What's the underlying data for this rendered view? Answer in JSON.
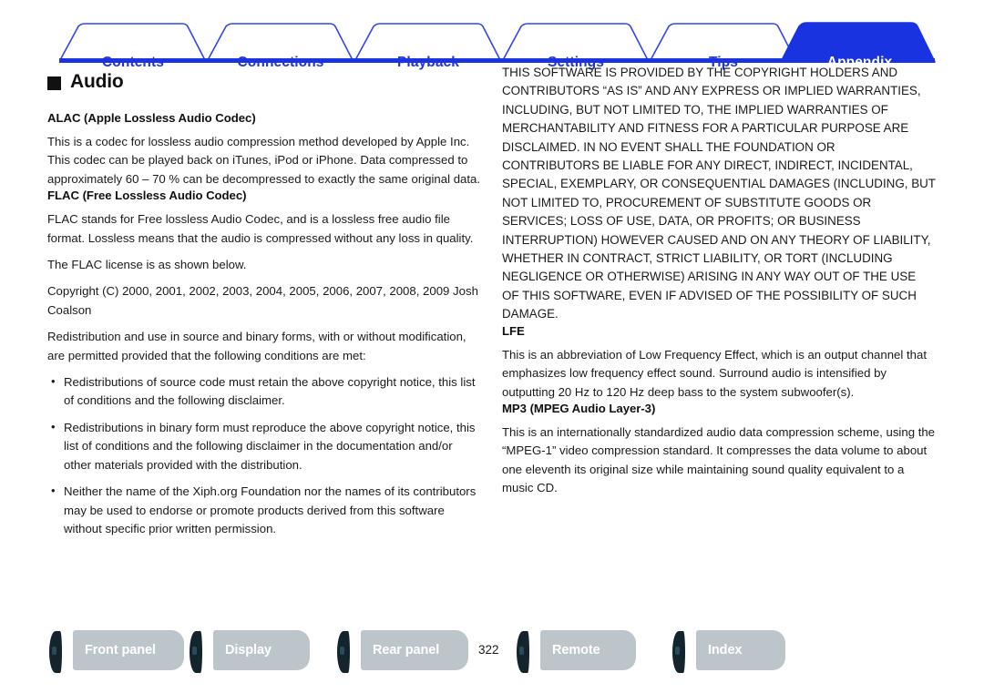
{
  "nav": {
    "tabs": [
      {
        "label": "Contents",
        "active": false
      },
      {
        "label": "Connections",
        "active": false
      },
      {
        "label": "Playback",
        "active": false
      },
      {
        "label": "Settings",
        "active": false
      },
      {
        "label": "Tips",
        "active": false
      },
      {
        "label": "Appendix",
        "active": true
      }
    ],
    "accent_color": "#2233dd",
    "active_tab_bg": "#1933e0"
  },
  "main": {
    "heading": "Audio",
    "left_column": {
      "sections": [
        {
          "heading": "ALAC (Apple Lossless Audio Codec)",
          "paragraphs": [
            "This is a codec for lossless audio compression method developed by Apple Inc. This codec can be played back on iTunes, iPod or iPhone. Data compressed to approximately 60 – 70 % can be decompressed to exactly the same original data."
          ]
        },
        {
          "heading": "FLAC (Free Lossless Audio Codec)",
          "paragraphs": [
            "FLAC stands for Free lossless Audio Codec, and is a lossless free audio file format. Lossless means that the audio is compressed without any loss in quality.",
            "The FLAC license is as shown below.",
            "Copyright (C) 2000, 2001, 2002, 2003, 2004, 2005, 2006, 2007, 2008, 2009 Josh Coalson",
            "Redistribution and use in source and binary forms, with or without modification, are permitted provided that the following conditions are met:"
          ],
          "bullets": [
            "Redistributions of source code must retain the above copyright notice, this list of conditions and the following disclaimer.",
            "Redistributions in binary form must reproduce the above copyright notice, this list of conditions and the following disclaimer in the documentation and/or other materials provided with the distribution.",
            "Neither the name of the Xiph.org Foundation nor the names of its contributors may be used to endorse or promote products derived from this software without specific prior written permission."
          ]
        }
      ]
    },
    "right_column": {
      "disclaimer": "THIS SOFTWARE IS PROVIDED BY THE COPYRIGHT HOLDERS AND CONTRIBUTORS “AS IS” AND ANY EXPRESS OR IMPLIED WARRANTIES, INCLUDING, BUT NOT LIMITED TO, THE IMPLIED WARRANTIES OF MERCHANTABILITY AND FITNESS FOR A PARTICULAR PURPOSE ARE DISCLAIMED. IN NO EVENT SHALL THE FOUNDATION OR CONTRIBUTORS BE LIABLE FOR ANY DIRECT, INDIRECT, INCIDENTAL, SPECIAL, EXEMPLARY, OR CONSEQUENTIAL DAMAGES (INCLUDING, BUT NOT LIMITED TO, PROCUREMENT OF SUBSTITUTE GOODS OR SERVICES; LOSS OF USE, DATA, OR PROFITS; OR BUSINESS INTERRUPTION) HOWEVER CAUSED AND ON ANY THEORY OF LIABILITY, WHETHER IN CONTRACT, STRICT LIABILITY, OR TORT (INCLUDING NEGLIGENCE OR OTHERWISE) ARISING IN ANY WAY OUT OF THE USE OF THIS SOFTWARE, EVEN IF ADVISED OF THE POSSIBILITY OF SUCH DAMAGE.",
      "sections": [
        {
          "heading": "LFE",
          "paragraphs": [
            "This is an abbreviation of Low Frequency Effect, which is an output channel that emphasizes low frequency effect sound. Surround audio is intensified by outputting 20 Hz to 120 Hz deep bass to the system subwoofer(s)."
          ]
        },
        {
          "heading": "MP3 (MPEG Audio Layer-3)",
          "paragraphs": [
            "This is an internationally standardized audio data compression scheme, using the “MPEG-1” video compression standard. It compresses the data volume to about one eleventh its original size while maintaining sound quality equivalent to a music CD."
          ]
        }
      ]
    }
  },
  "footer": {
    "page_number": "322",
    "buttons": [
      {
        "label": "Front panel"
      },
      {
        "label": "Display"
      },
      {
        "label": "Rear panel"
      },
      {
        "label": "Remote"
      },
      {
        "label": "Index"
      }
    ],
    "button_color": "#bcc6ca",
    "tab_color": "#14242c"
  }
}
